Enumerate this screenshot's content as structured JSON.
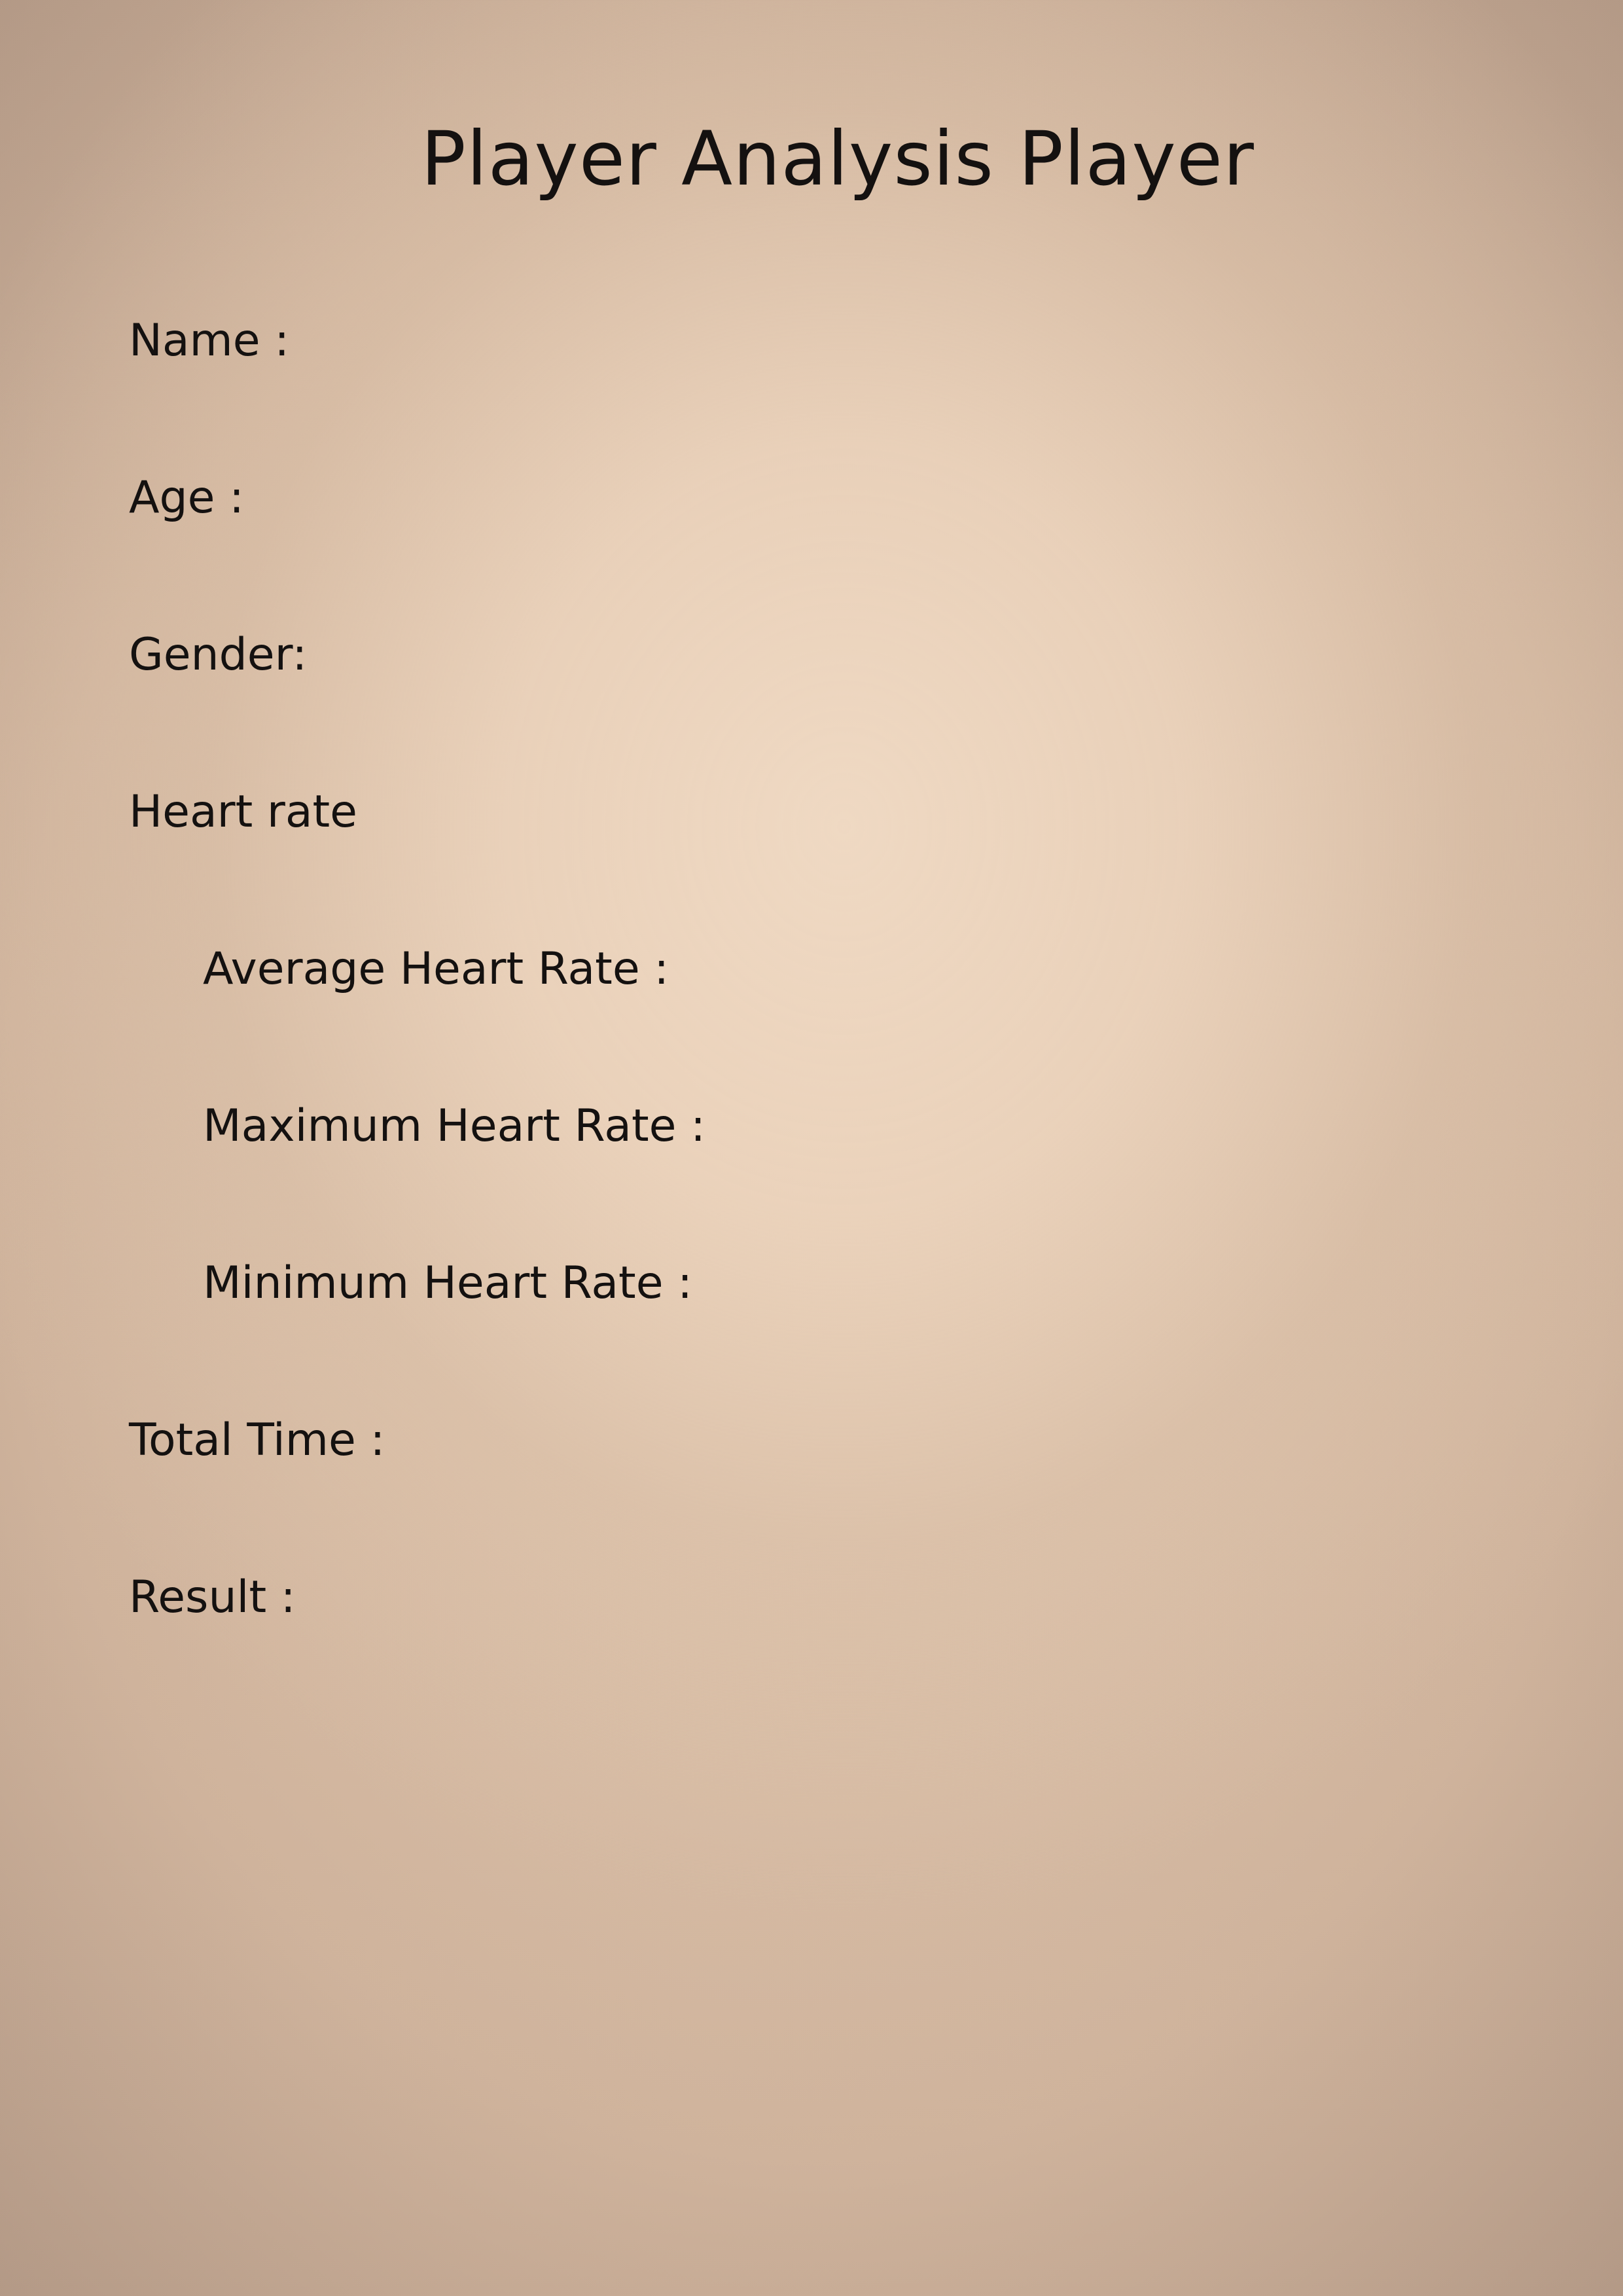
{
  "document": {
    "title": "Player Analysis Player",
    "fields": {
      "name": "Name :",
      "age": "Age :",
      "gender": "Gender:",
      "heart_rate_heading": "Heart rate",
      "average_heart_rate": "Average Heart Rate :",
      "maximum_heart_rate": "Maximum Heart Rate :",
      "minimum_heart_rate": "Minimum Heart Rate :",
      "total_time": "Total Time :",
      "result": "Result :"
    }
  },
  "colors": {
    "text": "#141110",
    "background_center": "#f0dac4",
    "background_edge": "#a48c7b"
  }
}
